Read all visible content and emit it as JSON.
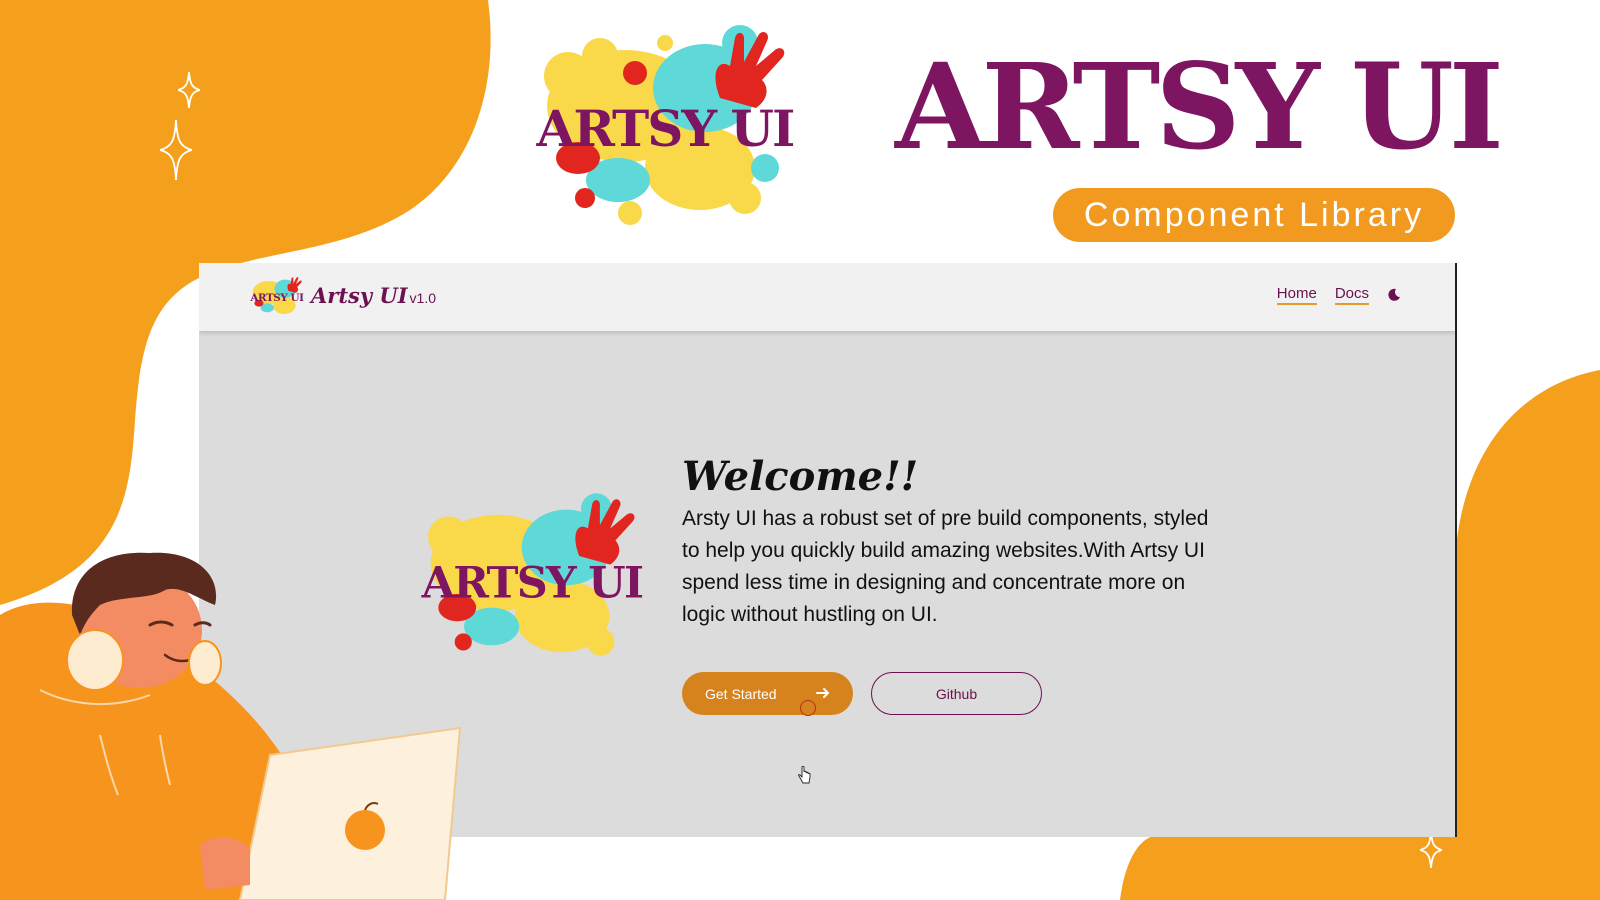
{
  "banner": {
    "title": "ARTSY UI",
    "subtitle": "Component Library",
    "logo_text": "ARTSY UI"
  },
  "app": {
    "navbar": {
      "logo_text": "ARTSY UI",
      "brand": "Artsy UI",
      "version": "v1.0",
      "links": [
        {
          "label": "Home"
        },
        {
          "label": "Docs"
        }
      ],
      "theme_icon": "moon-icon"
    },
    "welcome": {
      "logo_text": "ARTSY UI",
      "heading": "Welcome!!",
      "body": "Arsty UI has a robust set of pre build components, styled to help you quickly build amazing websites.With Artsy UI spend less time in designing and concentrate more on logic without hustling on UI.",
      "primary_button": "Get Started",
      "secondary_button": "Github"
    }
  },
  "colors": {
    "brand_purple": "#7d1560",
    "accent_orange": "#f29a1f",
    "app_background": "#dcdcdc",
    "navbar_background": "#f1f1f1"
  }
}
